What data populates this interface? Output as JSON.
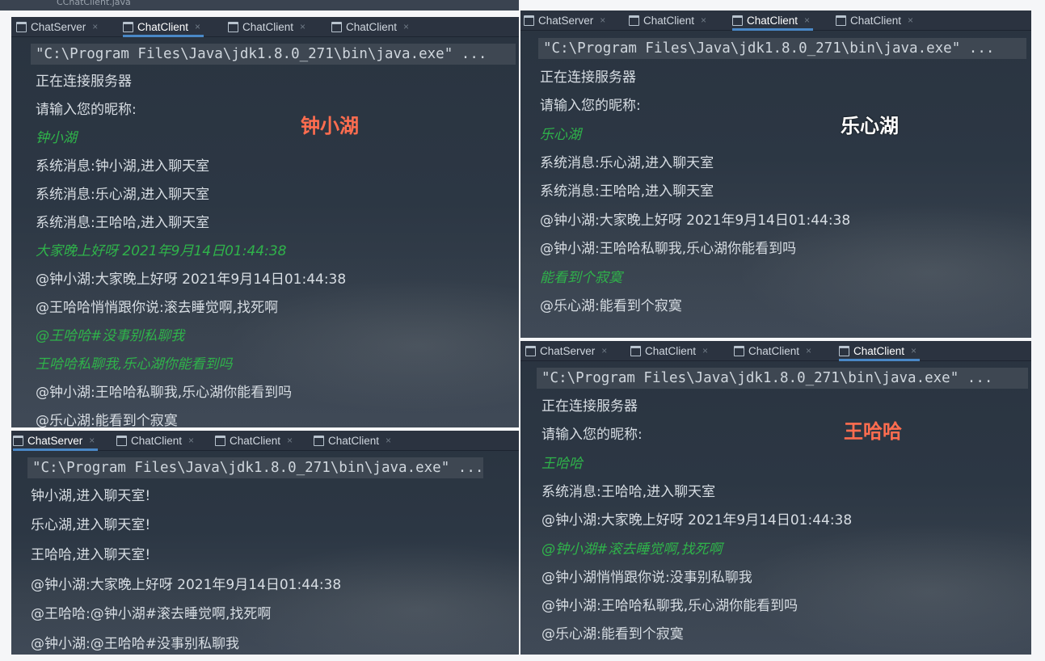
{
  "top_strip_text": "CChatClient.java",
  "tab_labels": [
    "ChatServer",
    "ChatClient",
    "ChatClient",
    "ChatClient"
  ],
  "panels": {
    "top_left": {
      "active_tab": 1,
      "nickname_label": "钟小湖",
      "nickname_color": "#ff6d4f",
      "lines": [
        {
          "type": "cmd",
          "text": "\"C:\\Program Files\\Java\\jdk1.8.0_271\\bin\\java.exe\" ..."
        },
        {
          "type": "sys",
          "text": "正在连接服务器"
        },
        {
          "type": "sys",
          "text": "请输入您的昵称:"
        },
        {
          "type": "input",
          "text": "钟小湖"
        },
        {
          "type": "sys",
          "text": "系统消息:钟小湖,进入聊天室"
        },
        {
          "type": "sys",
          "text": "系统消息:乐心湖,进入聊天室"
        },
        {
          "type": "sys",
          "text": "系统消息:王哈哈,进入聊天室"
        },
        {
          "type": "input",
          "text": "大家晚上好呀 2021年9月14日01:44:38"
        },
        {
          "type": "sys",
          "text": "@钟小湖:大家晚上好呀 2021年9月14日01:44:38"
        },
        {
          "type": "sys",
          "text": "@王哈哈悄悄跟你说:滚去睡觉啊,找死啊"
        },
        {
          "type": "input",
          "text": "@王哈哈#没事别私聊我"
        },
        {
          "type": "input",
          "text": "王哈哈私聊我,乐心湖你能看到吗"
        },
        {
          "type": "sys",
          "text": "@钟小湖:王哈哈私聊我,乐心湖你能看到吗"
        },
        {
          "type": "sys",
          "text": "@乐心湖:能看到个寂寞"
        }
      ]
    },
    "top_right": {
      "active_tab": 2,
      "nickname_label": "乐心湖",
      "nickname_color": "#ffffff",
      "lines": [
        {
          "type": "cmd",
          "text": "\"C:\\Program Files\\Java\\jdk1.8.0_271\\bin\\java.exe\" ..."
        },
        {
          "type": "sys",
          "text": "正在连接服务器"
        },
        {
          "type": "sys",
          "text": "请输入您的昵称:"
        },
        {
          "type": "input",
          "text": "乐心湖"
        },
        {
          "type": "sys",
          "text": "系统消息:乐心湖,进入聊天室"
        },
        {
          "type": "sys",
          "text": "系统消息:王哈哈,进入聊天室"
        },
        {
          "type": "sys",
          "text": "@钟小湖:大家晚上好呀 2021年9月14日01:44:38"
        },
        {
          "type": "sys",
          "text": "@钟小湖:王哈哈私聊我,乐心湖你能看到吗"
        },
        {
          "type": "input",
          "text": "能看到个寂寞"
        },
        {
          "type": "sys",
          "text": "@乐心湖:能看到个寂寞"
        }
      ]
    },
    "bottom_left": {
      "active_tab": 0,
      "lines": [
        {
          "type": "cmd",
          "text": "\"C:\\Program Files\\Java\\jdk1.8.0_271\\bin\\java.exe\" ..."
        },
        {
          "type": "sys",
          "text": "钟小湖,进入聊天室!"
        },
        {
          "type": "sys",
          "text": "乐心湖,进入聊天室!"
        },
        {
          "type": "sys",
          "text": "王哈哈,进入聊天室!"
        },
        {
          "type": "sys",
          "text": "@钟小湖:大家晚上好呀 2021年9月14日01:44:38"
        },
        {
          "type": "sys",
          "text": "@王哈哈:@钟小湖#滚去睡觉啊,找死啊"
        },
        {
          "type": "sys",
          "text": "@钟小湖:@王哈哈#没事别私聊我"
        }
      ]
    },
    "bottom_right": {
      "active_tab": 3,
      "nickname_label": "王哈哈",
      "nickname_color": "#ff6d4f",
      "lines": [
        {
          "type": "cmd",
          "text": "\"C:\\Program Files\\Java\\jdk1.8.0_271\\bin\\java.exe\" ..."
        },
        {
          "type": "sys",
          "text": "正在连接服务器"
        },
        {
          "type": "sys",
          "text": "请输入您的昵称:"
        },
        {
          "type": "input",
          "text": "王哈哈"
        },
        {
          "type": "sys",
          "text": "系统消息:王哈哈,进入聊天室"
        },
        {
          "type": "sys",
          "text": "@钟小湖:大家晚上好呀 2021年9月14日01:44:38"
        },
        {
          "type": "input",
          "text": "@钟小湖#滚去睡觉啊,找死啊"
        },
        {
          "type": "sys",
          "text": "@钟小湖悄悄跟你说:没事别私聊我"
        },
        {
          "type": "sys",
          "text": "@钟小湖:王哈哈私聊我,乐心湖你能看到吗"
        },
        {
          "type": "sys",
          "text": "@乐心湖:能看到个寂寞"
        }
      ]
    }
  }
}
